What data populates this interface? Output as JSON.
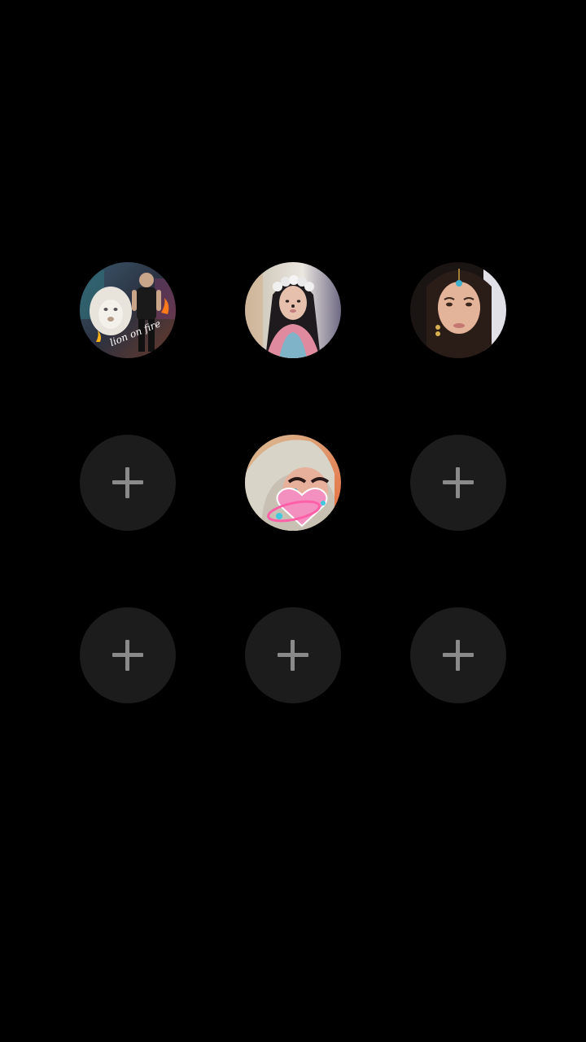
{
  "grid": {
    "slots": [
      {
        "type": "avatar",
        "avatar_icon": "lion-on-fire-avatar-icon",
        "overlay_text": "lion on fire"
      },
      {
        "type": "avatar",
        "avatar_icon": "girl-flower-crown-avatar-icon"
      },
      {
        "type": "avatar",
        "avatar_icon": "woman-portrait-avatar-icon"
      },
      {
        "type": "add",
        "icon": "plus-icon"
      },
      {
        "type": "avatar",
        "avatar_icon": "hijab-heart-filter-avatar-icon"
      },
      {
        "type": "add",
        "icon": "plus-icon"
      },
      {
        "type": "add",
        "icon": "plus-icon"
      },
      {
        "type": "add",
        "icon": "plus-icon"
      },
      {
        "type": "add",
        "icon": "plus-icon"
      }
    ]
  },
  "colors": {
    "background": "#000000",
    "empty_slot": "#1c1c1c",
    "plus_icon": "#8a8a8a"
  }
}
